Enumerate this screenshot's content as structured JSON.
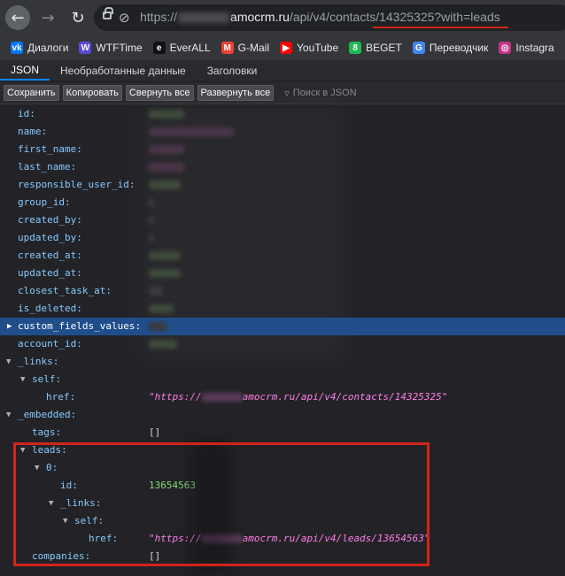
{
  "browser": {
    "url_scheme": "https://",
    "url_host": "amocrm.ru",
    "url_path": "/api/v4/contacts/",
    "url_query": "14325325?with=leads"
  },
  "bookmarks": [
    {
      "label": "Диалоги",
      "icon": "vk-icon",
      "color": "#0077ff",
      "glyph": "vk"
    },
    {
      "label": "WTFTime",
      "icon": "wtftime-icon",
      "color": "#5b4bd6",
      "glyph": "W"
    },
    {
      "label": "EverALL",
      "icon": "everall-icon",
      "color": "#111111",
      "glyph": "e"
    },
    {
      "label": "G-Mail",
      "icon": "gmail-icon",
      "color": "#ea4335",
      "glyph": "M"
    },
    {
      "label": "YouTube",
      "icon": "youtube-icon",
      "color": "#ff0000",
      "glyph": "▶"
    },
    {
      "label": "BEGET",
      "icon": "beget-icon",
      "color": "#1db954",
      "glyph": "8"
    },
    {
      "label": "Переводчик",
      "icon": "translate-icon",
      "color": "#4285f4",
      "glyph": "G"
    },
    {
      "label": "Instagra",
      "icon": "instagram-icon",
      "color": "#c13584",
      "glyph": "◎"
    }
  ],
  "tabs": [
    "JSON",
    "Необработанные данные",
    "Заголовки"
  ],
  "toolbar": {
    "save": "Сохранить",
    "copy": "Копировать",
    "collapse": "Свернуть все",
    "expand": "Развернуть все",
    "filter_placeholder": "Поиск в JSON"
  },
  "rows": [
    {
      "key": "id:",
      "type": "blur"
    },
    {
      "key": "name:",
      "type": "blur"
    },
    {
      "key": "first_name:",
      "type": "blur"
    },
    {
      "key": "last_name:",
      "type": "blur"
    },
    {
      "key": "responsible_user_id:",
      "type": "blur"
    },
    {
      "key": "group_id:",
      "type": "blur"
    },
    {
      "key": "created_by:",
      "type": "blur"
    },
    {
      "key": "updated_by:",
      "type": "blur"
    },
    {
      "key": "created_at:",
      "type": "blur"
    },
    {
      "key": "updated_at:",
      "type": "blur"
    },
    {
      "key": "closest_task_at:",
      "type": "blur"
    },
    {
      "key": "is_deleted:",
      "type": "blur"
    },
    {
      "key": "custom_fields_values:",
      "type": "blur",
      "caret": "collapsed",
      "selected": true
    },
    {
      "key": "account_id:",
      "type": "blur"
    },
    {
      "key": "_links:",
      "caret": "expanded"
    },
    {
      "key": "self:",
      "caret": "expanded"
    },
    {
      "key": "href:",
      "type": "str",
      "value": "\"https://",
      "value_tail": "amocrm.ru/api/v4/contacts/14325325\""
    },
    {
      "key": "_embedded:",
      "caret": "expanded"
    },
    {
      "key": "tags:",
      "type": "plain",
      "value": "[]"
    },
    {
      "key": "leads:",
      "caret": "expanded"
    },
    {
      "key": "0:",
      "caret": "expanded"
    },
    {
      "key": "id:",
      "type": "num",
      "value": "13654563"
    },
    {
      "key": "_links:",
      "caret": "expanded"
    },
    {
      "key": "self:",
      "caret": "expanded"
    },
    {
      "key": "href:",
      "type": "str",
      "value": "\"https://",
      "value_tail": "amocrm.ru/api/v4/leads/13654563\""
    },
    {
      "key": "companies:",
      "type": "plain",
      "value": "[]"
    }
  ]
}
